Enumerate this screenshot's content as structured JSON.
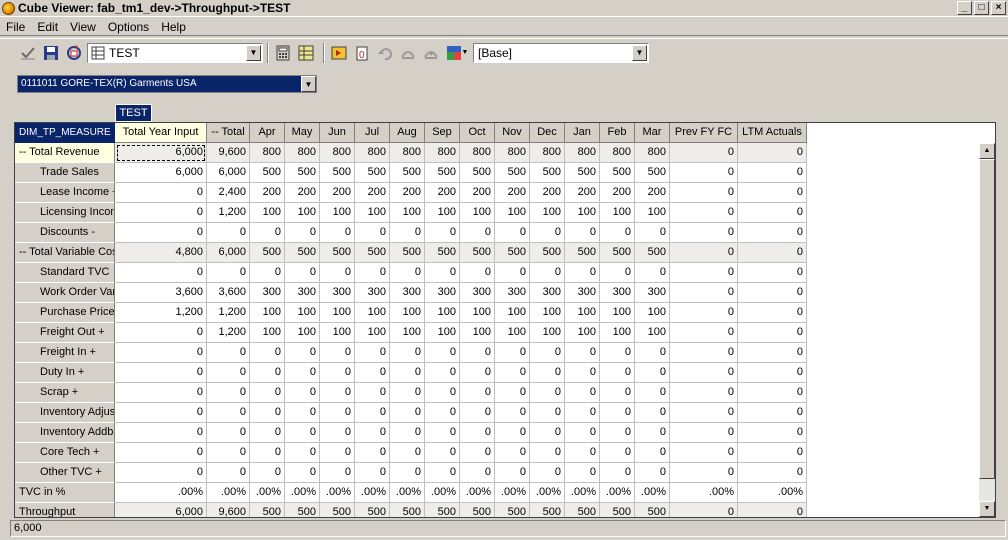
{
  "window": {
    "title": "Cube Viewer: fab_tm1_dev->Throughput->TEST",
    "minimize": "_",
    "maximize": "□",
    "close": "×"
  },
  "menu": [
    "File",
    "Edit",
    "View",
    "Options",
    "Help"
  ],
  "toolbar": {
    "view_combo": "TEST",
    "base_combo": "[Base]",
    "icons": [
      "check-icon",
      "save-icon",
      "recalc-icon",
      "view-icon",
      "calc-icon",
      "sheet-icon",
      "export-icon",
      "zero-out-icon",
      "undo-icon",
      "redo-icon",
      "redo-all-icon",
      "sandbox-icon"
    ]
  },
  "filter": {
    "label": "0111011 GORE-TEX(R) Garments USA"
  },
  "column_dimension_tab": "TEST",
  "grid": {
    "corner": "DIM_TP_MEASURE",
    "columns": [
      "Total Year Input",
      "-- Total",
      "Apr",
      "May",
      "Jun",
      "Jul",
      "Aug",
      "Sep",
      "Oct",
      "Nov",
      "Dec",
      "Jan",
      "Feb",
      "Mar",
      "Prev FY FC",
      "LTM Actuals"
    ],
    "rows": [
      {
        "label": "-- Total Revenue",
        "indent": false,
        "shaded": true,
        "current": true,
        "values": [
          "6,000",
          "9,600",
          "800",
          "800",
          "800",
          "800",
          "800",
          "800",
          "800",
          "800",
          "800",
          "800",
          "800",
          "800",
          "0",
          "0"
        ]
      },
      {
        "label": "Trade Sales",
        "indent": true,
        "shaded": false,
        "values": [
          "6,000",
          "6,000",
          "500",
          "500",
          "500",
          "500",
          "500",
          "500",
          "500",
          "500",
          "500",
          "500",
          "500",
          "500",
          "0",
          "0"
        ]
      },
      {
        "label": "Lease Income  +",
        "indent": true,
        "shaded": false,
        "values": [
          "0",
          "2,400",
          "200",
          "200",
          "200",
          "200",
          "200",
          "200",
          "200",
          "200",
          "200",
          "200",
          "200",
          "200",
          "0",
          "0"
        ]
      },
      {
        "label": "Licensing Income",
        "indent": true,
        "shaded": false,
        "values": [
          "0",
          "1,200",
          "100",
          "100",
          "100",
          "100",
          "100",
          "100",
          "100",
          "100",
          "100",
          "100",
          "100",
          "100",
          "0",
          "0"
        ]
      },
      {
        "label": "Discounts  -",
        "indent": true,
        "shaded": false,
        "values": [
          "0",
          "0",
          "0",
          "0",
          "0",
          "0",
          "0",
          "0",
          "0",
          "0",
          "0",
          "0",
          "0",
          "0",
          "0",
          "0"
        ]
      },
      {
        "label": "-- Total Variable Costs",
        "indent": false,
        "shaded": true,
        "values": [
          "4,800",
          "6,000",
          "500",
          "500",
          "500",
          "500",
          "500",
          "500",
          "500",
          "500",
          "500",
          "500",
          "500",
          "500",
          "0",
          "0"
        ]
      },
      {
        "label": "Standard TVC",
        "indent": true,
        "shaded": false,
        "values": [
          "0",
          "0",
          "0",
          "0",
          "0",
          "0",
          "0",
          "0",
          "0",
          "0",
          "0",
          "0",
          "0",
          "0",
          "0",
          "0"
        ]
      },
      {
        "label": "Work Order Variance",
        "indent": true,
        "shaded": false,
        "values": [
          "3,600",
          "3,600",
          "300",
          "300",
          "300",
          "300",
          "300",
          "300",
          "300",
          "300",
          "300",
          "300",
          "300",
          "300",
          "0",
          "0"
        ]
      },
      {
        "label": "Purchase Price",
        "indent": true,
        "shaded": false,
        "values": [
          "1,200",
          "1,200",
          "100",
          "100",
          "100",
          "100",
          "100",
          "100",
          "100",
          "100",
          "100",
          "100",
          "100",
          "100",
          "0",
          "0"
        ]
      },
      {
        "label": "Freight Out  +",
        "indent": true,
        "shaded": false,
        "values": [
          "0",
          "1,200",
          "100",
          "100",
          "100",
          "100",
          "100",
          "100",
          "100",
          "100",
          "100",
          "100",
          "100",
          "100",
          "0",
          "0"
        ]
      },
      {
        "label": "Freight In  +",
        "indent": true,
        "shaded": false,
        "values": [
          "0",
          "0",
          "0",
          "0",
          "0",
          "0",
          "0",
          "0",
          "0",
          "0",
          "0",
          "0",
          "0",
          "0",
          "0",
          "0"
        ]
      },
      {
        "label": "Duty In  +",
        "indent": true,
        "shaded": false,
        "values": [
          "0",
          "0",
          "0",
          "0",
          "0",
          "0",
          "0",
          "0",
          "0",
          "0",
          "0",
          "0",
          "0",
          "0",
          "0",
          "0"
        ]
      },
      {
        "label": "Scrap  +",
        "indent": true,
        "shaded": false,
        "values": [
          "0",
          "0",
          "0",
          "0",
          "0",
          "0",
          "0",
          "0",
          "0",
          "0",
          "0",
          "0",
          "0",
          "0",
          "0",
          "0"
        ]
      },
      {
        "label": "Inventory Adjustments",
        "indent": true,
        "shaded": false,
        "values": [
          "0",
          "0",
          "0",
          "0",
          "0",
          "0",
          "0",
          "0",
          "0",
          "0",
          "0",
          "0",
          "0",
          "0",
          "0",
          "0"
        ]
      },
      {
        "label": "Inventory Addbacks",
        "indent": true,
        "shaded": false,
        "values": [
          "0",
          "0",
          "0",
          "0",
          "0",
          "0",
          "0",
          "0",
          "0",
          "0",
          "0",
          "0",
          "0",
          "0",
          "0",
          "0"
        ]
      },
      {
        "label": "Core Tech  +",
        "indent": true,
        "shaded": false,
        "values": [
          "0",
          "0",
          "0",
          "0",
          "0",
          "0",
          "0",
          "0",
          "0",
          "0",
          "0",
          "0",
          "0",
          "0",
          "0",
          "0"
        ]
      },
      {
        "label": "Other TVC  +",
        "indent": true,
        "shaded": false,
        "values": [
          "0",
          "0",
          "0",
          "0",
          "0",
          "0",
          "0",
          "0",
          "0",
          "0",
          "0",
          "0",
          "0",
          "0",
          "0",
          "0"
        ]
      },
      {
        "label": "TVC in %",
        "indent": false,
        "shaded": false,
        "values": [
          ".00%",
          ".00%",
          ".00%",
          ".00%",
          ".00%",
          ".00%",
          ".00%",
          ".00%",
          ".00%",
          ".00%",
          ".00%",
          ".00%",
          ".00%",
          ".00%",
          ".00%",
          ".00%"
        ]
      },
      {
        "label": "Throughput",
        "indent": false,
        "shaded": true,
        "values": [
          "6,000",
          "9,600",
          "500",
          "500",
          "500",
          "500",
          "500",
          "500",
          "500",
          "500",
          "500",
          "500",
          "500",
          "500",
          "0",
          "0"
        ]
      }
    ]
  },
  "status": {
    "value": "6,000"
  }
}
